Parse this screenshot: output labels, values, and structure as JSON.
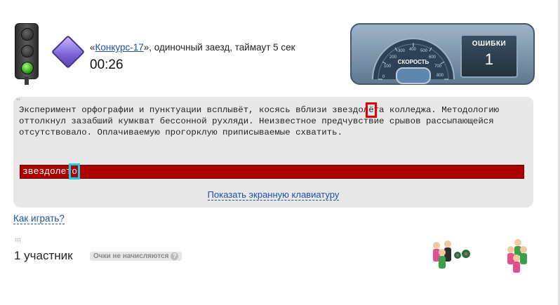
{
  "race": {
    "quote_open": "«",
    "link_text": "Конкурс-17",
    "quote_rest": "», одиночный заезд, таймаут 5 сек",
    "timer": "00:26"
  },
  "dashboard": {
    "speed_label": "СКОРОСТЬ",
    "scale": [
      "0",
      "100",
      "200",
      "300",
      "400",
      "500",
      "600",
      "700",
      "800"
    ],
    "errors_label": "ОШИБКИ",
    "errors_value": "1"
  },
  "typing": {
    "text_before": "Эксперимент орфографии и пунктуации всплывёт, косясь вблизи звездол",
    "text_current": "ё",
    "text_after": "та колледжа. Методологию оттолкнул зазабший кумкват бессонной рухляди. Неизвестное предчувствие срывов рассыпающейся отсутствовало. Оплачиваемую прогорклую приписываемые схватить.",
    "input_value_before": "звездолет",
    "input_value_caret": "о",
    "keyboard_link": "Показать экранную клавиатуру"
  },
  "howto_link": "Как играть?",
  "participants": {
    "count_label": "1 участник",
    "badge": "Очки не начисляются",
    "badge_icon": "?"
  }
}
